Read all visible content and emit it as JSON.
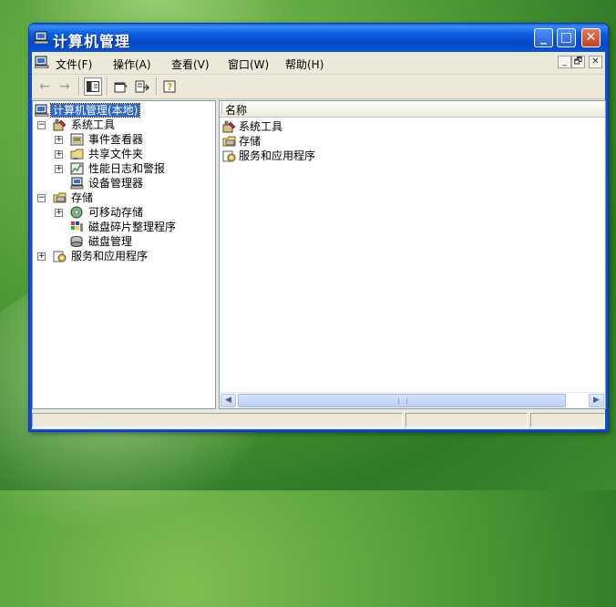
{
  "window": {
    "title": "计算机管理"
  },
  "title_buttons": {
    "minimize": "_",
    "maximize": "□",
    "close": "✕"
  },
  "menu": [
    {
      "label": "文件(F)"
    },
    {
      "label": "操作(A)"
    },
    {
      "label": "查看(V)"
    },
    {
      "label": "窗口(W)"
    },
    {
      "label": "帮助(H)"
    }
  ],
  "mdi_controls": {
    "minimize": "_",
    "restore": "🗗",
    "close": "✕"
  },
  "toolbar": {
    "back_glyph": "←",
    "forward_glyph": "→",
    "show_tree_icon": "console-tree-icon",
    "properties_icon": "properties-icon",
    "export_icon": "export-list-icon",
    "help_icon": "help-icon"
  },
  "tree": {
    "root": "计算机管理(本地)",
    "items": [
      {
        "label": "系统工具",
        "level": 1,
        "expander": "-",
        "icon": "tools-icon"
      },
      {
        "label": "事件查看器",
        "level": 2,
        "expander": "+",
        "icon": "event-viewer-icon"
      },
      {
        "label": "共享文件夹",
        "level": 2,
        "expander": "+",
        "icon": "shared-folder-icon"
      },
      {
        "label": "性能日志和警报",
        "level": 2,
        "expander": "+",
        "icon": "performance-icon"
      },
      {
        "label": "设备管理器",
        "level": 2,
        "expander": "",
        "icon": "device-manager-icon"
      },
      {
        "label": "存储",
        "level": 1,
        "expander": "-",
        "icon": "storage-icon"
      },
      {
        "label": "可移动存储",
        "level": 2,
        "expander": "+",
        "icon": "removable-storage-icon"
      },
      {
        "label": "磁盘碎片整理程序",
        "level": 2,
        "expander": "",
        "icon": "defrag-icon"
      },
      {
        "label": "磁盘管理",
        "level": 2,
        "expander": "",
        "icon": "disk-management-icon"
      },
      {
        "label": "服务和应用程序",
        "level": 1,
        "expander": "+",
        "icon": "services-icon"
      }
    ]
  },
  "list": {
    "column_header": "名称",
    "rows": [
      {
        "label": "系统工具",
        "icon": "tools-icon"
      },
      {
        "label": "存储",
        "icon": "storage-icon"
      },
      {
        "label": "服务和应用程序",
        "icon": "services-icon"
      }
    ]
  },
  "colors": {
    "titlebar": "#0a5fe4",
    "selection": "#316ac5",
    "window_bg": "#ece9d8"
  }
}
